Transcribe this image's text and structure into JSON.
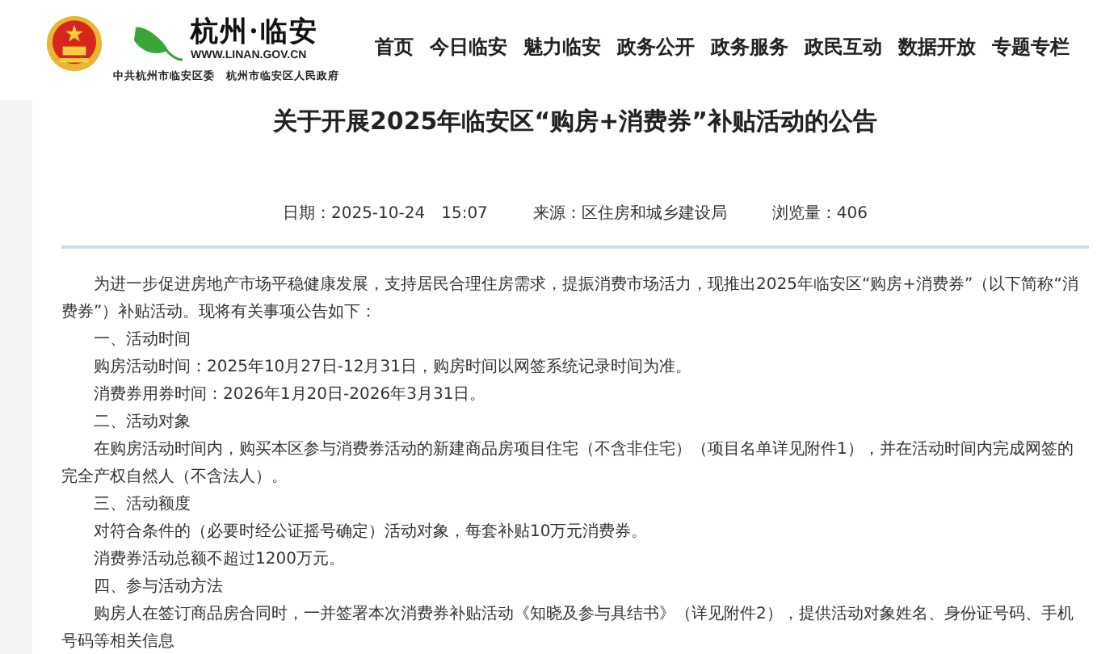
{
  "header": {
    "logo_text": "杭州·临安",
    "site_url": "WWW.LINAN.GOV.CN",
    "org_names": "中共杭州市临安区委　杭州市临安区人民政府",
    "nav": [
      {
        "label": "首页"
      },
      {
        "label": "今日临安"
      },
      {
        "label": "魅力临安"
      },
      {
        "label": "政务公开"
      },
      {
        "label": "政务服务"
      },
      {
        "label": "政民互动"
      },
      {
        "label": "数据开放"
      },
      {
        "label": "专题专栏"
      }
    ]
  },
  "article": {
    "title": "关于开展2025年临安区“购房+消费券”补贴活动的公告",
    "meta": [
      {
        "text": "日期：2025-10-24　15:07"
      },
      {
        "text": "来源：区住房和城乡建设局"
      },
      {
        "text": "浏览量：406"
      }
    ],
    "paragraphs": [
      "为进一步促进房地产市场平稳健康发展，支持居民合理住房需求，提振消费市场活力，现推出2025年临安区“购房+消费券”（以下简称“消费券”）补贴活动。现将有关事项公告如下：",
      "一、活动时间",
      "购房活动时间：2025年10月27日-12月31日，购房时间以网签系统记录时间为准。",
      "消费券用券时间：2026年1月20日-2026年3月31日。",
      "二、活动对象",
      "在购房活动时间内，购买本区参与消费券活动的新建商品房项目住宅（不含非住宅）（项目名单详见附件1），并在活动时间内完成网签的完全产权自然人（不含法人）。",
      "三、活动额度",
      "对符合条件的（必要时经公证摇号确定）活动对象，每套补贴10万元消费券。",
      "消费券活动总额不超过1200万元。",
      "四、参与活动方法",
      "购房人在签订商品房合同时，一并签署本次消费券补贴活动《知晓及参与具结书》（详见附件2），提供活动对象姓名、身份证号码、手机号码等相关信息"
    ]
  }
}
